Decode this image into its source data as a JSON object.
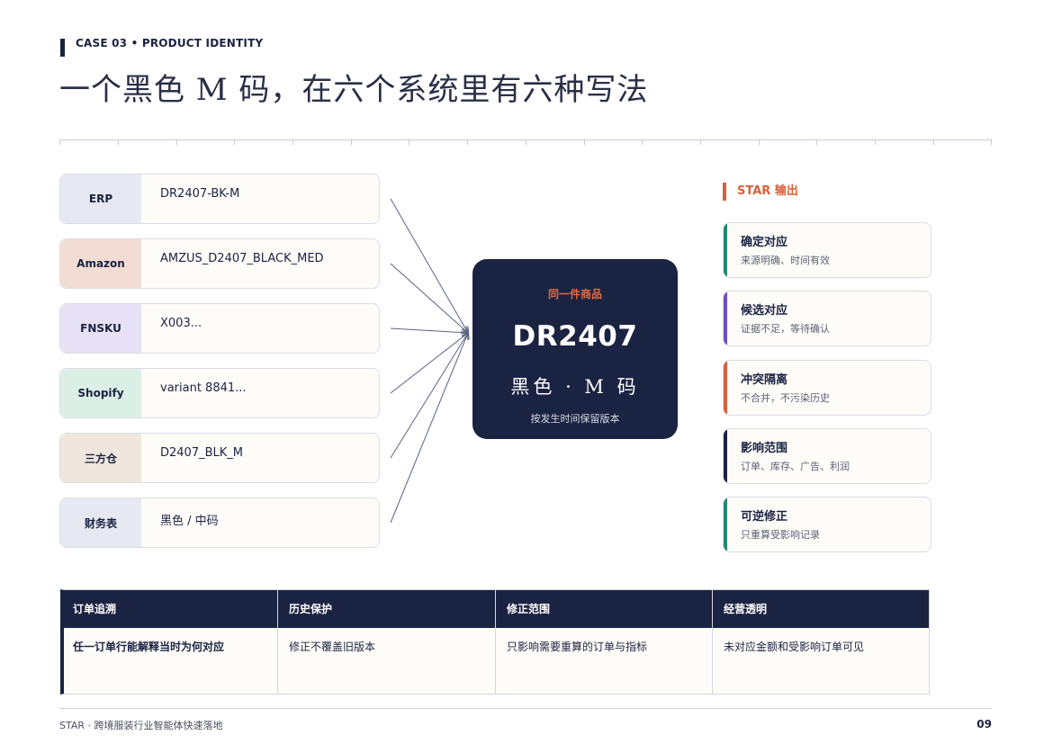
{
  "header": {
    "case_label": "CASE 03 • PRODUCT IDENTITY",
    "title": "一个黑色 M 码，在六个系统里有六种写法"
  },
  "systems": [
    {
      "name": "ERP",
      "code": "DR2407-BK-M",
      "color": "#e6e9f2"
    },
    {
      "name": "Amazon",
      "code": "AMZUS_D2407_BLACK_MED",
      "color": "#f2ddd4"
    },
    {
      "name": "FNSKU",
      "code": "X003...",
      "color": "#e7e1f6"
    },
    {
      "name": "Shopify",
      "code": "variant 8841...",
      "color": "#dcefe7"
    },
    {
      "name": "三方仓",
      "code": "D2407_BLK_M",
      "color": "#efe7dd"
    },
    {
      "name": "财务表",
      "code": "黑色 / 中码",
      "color": "#e6e9f2"
    }
  ],
  "hub": {
    "label": "同一件商品",
    "sku": "DR2407",
    "variant": "黑色 · M 码",
    "note": "按发生时间保留版本"
  },
  "output": {
    "label": "STAR 输出",
    "items": [
      {
        "title": "确定对应",
        "desc": "来源明确、时间有效",
        "color": "#1f8a70"
      },
      {
        "title": "候选对应",
        "desc": "证据不足，等待确认",
        "color": "#6e4fc4"
      },
      {
        "title": "冲突隔离",
        "desc": "不合并，不污染历史",
        "color": "#d9603a"
      },
      {
        "title": "影响范围",
        "desc": "订单、库存、广告、利润",
        "color": "#1b2342"
      },
      {
        "title": "可逆修正",
        "desc": "只重算受影响记录",
        "color": "#1f8a70"
      }
    ]
  },
  "table": {
    "headers": [
      "订单追溯",
      "历史保护",
      "修正范围",
      "经营透明"
    ],
    "row": [
      "任一订单行能解释当时为何对应",
      "修正不覆盖旧版本",
      "只影响需要重算的订单与指标",
      "未对应金额和受影响订单可见"
    ]
  },
  "footer": {
    "left": "STAR · 跨境服装行业智能体快速落地",
    "page": "09"
  },
  "colors": {
    "navy": "#1b2342",
    "accent": "#d9603a"
  }
}
